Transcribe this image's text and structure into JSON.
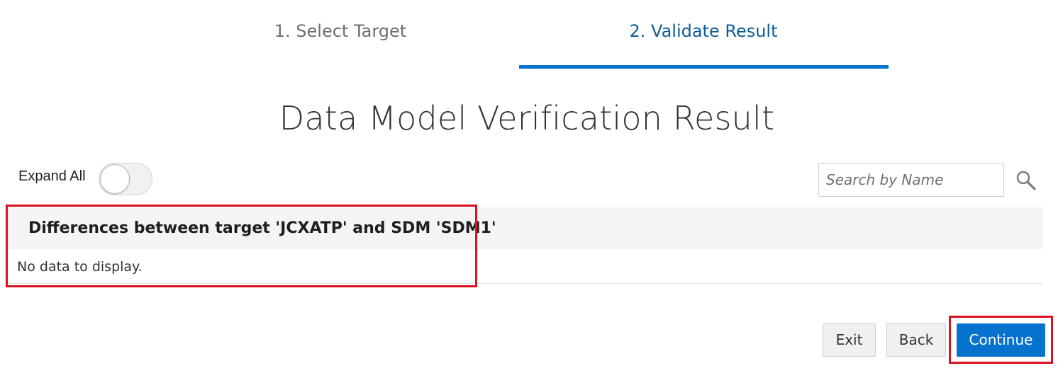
{
  "stepper": {
    "steps": [
      {
        "label": "1. Select Target",
        "state": "inactive"
      },
      {
        "label": "2. Validate Result",
        "state": "active"
      }
    ],
    "active_color": "#0572ce"
  },
  "title": "Data Model Verification Result",
  "expand_all": {
    "label": "Expand All",
    "checked": false
  },
  "search": {
    "placeholder": "Search by Name",
    "value": "",
    "icon": "search-icon"
  },
  "results": {
    "header": "Differences between target 'JCXATP' and SDM 'SDM1'",
    "empty_message": "No data to display."
  },
  "buttons": {
    "exit": "Exit",
    "back": "Back",
    "continue": "Continue"
  },
  "colors": {
    "primary": "#0572ce",
    "highlight": "#d9121f"
  }
}
